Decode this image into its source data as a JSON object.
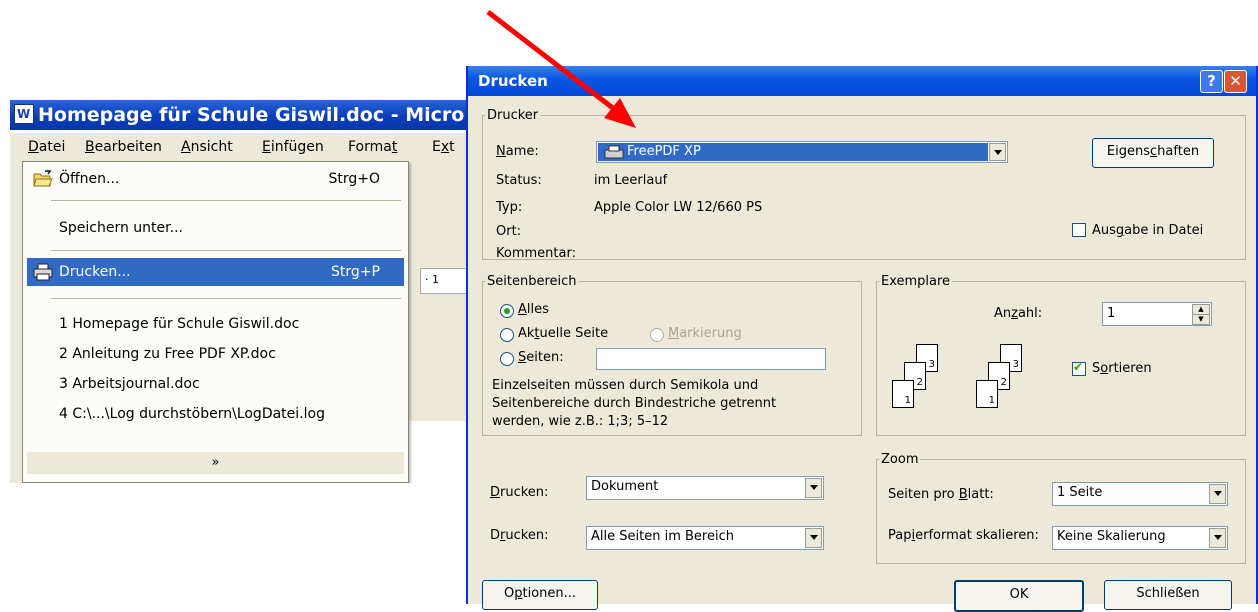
{
  "word": {
    "title": "Homepage für Schule Giswil.doc - Micro",
    "menu": [
      "Datei",
      "Bearbeiten",
      "Ansicht",
      "Einfügen",
      "Format",
      "Ext"
    ],
    "ruler_mark": "· 1",
    "dropdown": {
      "open": "Öffnen...",
      "open_shortcut": "Strg+O",
      "save_as": "Speichern unter...",
      "print": "Drucken...",
      "print_shortcut": "Strg+P",
      "recent": [
        "1 Homepage für Schule Giswil.doc",
        "2 Anleitung zu Free PDF XP.doc",
        "3 Arbeitsjournal.doc",
        "4 C:\\...\\Log durchstöbern\\LogDatei.log"
      ],
      "expand": "»"
    }
  },
  "dialog": {
    "title": "Drucken",
    "help": "?",
    "close": "✕",
    "printer": {
      "legend": "Drucker",
      "name_label": "Name:",
      "name_value": "FreePDF XP",
      "status_label": "Status:",
      "status_value": "im Leerlauf",
      "type_label": "Typ:",
      "type_value": "Apple Color LW 12/660 PS",
      "location_label": "Ort:",
      "comment_label": "Kommentar:",
      "properties_button": "Eigenschaften",
      "print_to_file": "Ausgabe in Datei"
    },
    "range": {
      "legend": "Seitenbereich",
      "all": "Alles",
      "current": "Aktuelle Seite",
      "selection": "Markierung",
      "pages": "Seiten:",
      "pages_value": "",
      "hint": [
        "Einzelseiten müssen durch Semikola und",
        "Seitenbereiche durch Bindestriche getrennt",
        "werden, wie z.B.: 1;3; 5–12"
      ]
    },
    "copies": {
      "legend": "Exemplare",
      "count_label": "Anzahl:",
      "count_value": "1",
      "collate": "Sortieren"
    },
    "print_what_label": "Drucken:",
    "print_what_value": "Dokument",
    "print_label": "Drucken:",
    "print_value": "Alle Seiten im Bereich",
    "zoom": {
      "legend": "Zoom",
      "pages_per_sheet_label": "Seiten pro Blatt:",
      "pages_per_sheet_value": "1 Seite",
      "scale_label": "Papierformat skalieren:",
      "scale_value": "Keine Skalierung"
    },
    "options_button": "Optionen...",
    "ok_button": "OK",
    "close_button": "Schließen"
  },
  "colors": {
    "highlight": "#316ac5",
    "dialog_bg": "#ece9d8",
    "titlebar": "#0a58e4",
    "arrow": "#ff0000"
  }
}
